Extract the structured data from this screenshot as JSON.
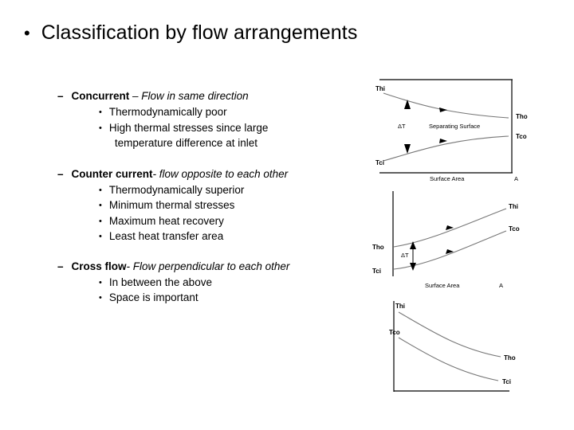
{
  "slide": {
    "title": "Classification by flow arrangements",
    "title_bullet": "•",
    "groups": [
      {
        "dash": "–",
        "head": "Concurrent",
        "tail": " – Flow in same direction",
        "sub_bullet": "•",
        "subs": [
          {
            "text": "Thermodynamically poor",
            "cont": ""
          },
          {
            "text": "High thermal stresses since large",
            "cont": "temperature difference at inlet"
          }
        ]
      },
      {
        "dash": "–",
        "head": "Counter current",
        "tail": "- flow opposite to each other",
        "sub_bullet": "•",
        "subs": [
          {
            "text": "Thermodynamically superior",
            "cont": ""
          },
          {
            "text": "Minimum thermal stresses",
            "cont": ""
          },
          {
            "text": "Maximum heat recovery",
            "cont": ""
          },
          {
            "text": "Least heat transfer area",
            "cont": ""
          }
        ]
      },
      {
        "dash": "–",
        "head": "Cross flow",
        "tail": "- Flow perpendicular to each other",
        "sub_bullet": "•",
        "subs": [
          {
            "text": "In between the above",
            "cont": ""
          },
          {
            "text": "Space is important",
            "cont": ""
          }
        ]
      }
    ]
  },
  "figures": {
    "parallel": {
      "name": "parallel-flow-temperature-profile",
      "labels": {
        "hot_in": "Thi",
        "cold_in": "Tci",
        "hot_out": "Tho",
        "cold_out": "Tco",
        "delta_t": "ΔT",
        "separating_surface": "Separating Surface",
        "x_axis": "Surface Area",
        "x_axis_symbol": "A"
      }
    },
    "counter": {
      "name": "counter-flow-temperature-profile",
      "labels": {
        "hot_out": "Tho",
        "cold_in": "Tci",
        "hot_in": "Thi",
        "cold_out": "Tco",
        "delta_t": "ΔT",
        "x_axis": "Surface Area",
        "x_axis_symbol": "A"
      }
    },
    "cross": {
      "name": "cross-flow-temperature-profile",
      "labels": {
        "hot_in": "Thi",
        "cold_out": "Tco",
        "hot_out": "Tho",
        "cold_in": "Tci"
      }
    }
  },
  "colors": {
    "ink": "#000000",
    "background": "#ffffff",
    "curve": "#666666"
  }
}
